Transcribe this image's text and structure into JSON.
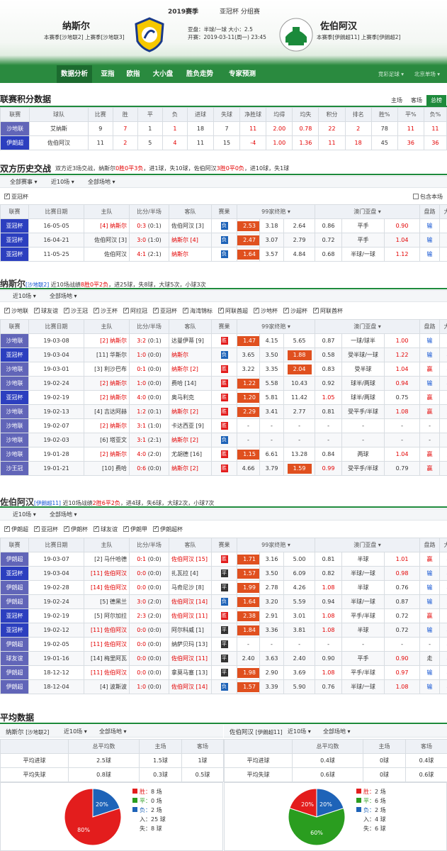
{
  "header": {
    "season": "2019赛季",
    "competition": "亚冠杯 分组赛",
    "home_team": "纳斯尔",
    "home_sub": "本赛季[沙地联2] 上赛季[沙地联3]",
    "away_team": "佐伯阿汉",
    "away_sub": "本赛季[伊朗超11] 上赛季[伊朗超2]",
    "handicap": "亚盘：半球/一球   大小：2.5",
    "kickoff": "开赛：2019-03-11(周一) 23:45"
  },
  "nav": {
    "items": [
      "数据分析",
      "亚指",
      "欧指",
      "大小盘",
      "胜负走势",
      "专家预测"
    ],
    "right1": "竞彩足球",
    "right2": "北京单场"
  },
  "league": {
    "title": "联赛积分数据",
    "tabs": [
      "主场",
      "客场",
      "总榜"
    ],
    "headers": [
      "联赛",
      "球队",
      "比赛",
      "胜",
      "平",
      "负",
      "进球",
      "失球",
      "净胜球",
      "均得",
      "均失",
      "积分",
      "排名",
      "胜%",
      "平%",
      "负%"
    ],
    "rows": [
      [
        "沙地联",
        "艾纳斯",
        "9",
        "7",
        "1",
        "1",
        "18",
        "7",
        "11",
        "2.00",
        "0.78",
        "22",
        "2",
        "78",
        "11",
        "11"
      ],
      [
        "伊朗超",
        "佐伯阿汉",
        "11",
        "2",
        "5",
        "4",
        "11",
        "15",
        "-4",
        "1.00",
        "1.36",
        "11",
        "18",
        "45",
        "36",
        "36"
      ]
    ]
  },
  "h2h": {
    "title": "双方历史交战",
    "summary_pre": "双方近3场交战，纳斯尔",
    "summary_rec1": "0胜0平3负",
    "summary_mid1": "，进1球，失10球，佐伯阿汉",
    "summary_rec2": "3胜0平0负",
    "summary_post": "，进10球，失1球",
    "filter1": "全部赛事",
    "filter2": "近10场",
    "filter3": "全部场地",
    "check1": "亚冠杯",
    "check2": "包含本场",
    "headers": [
      "联赛",
      "比赛日期",
      "主队",
      "比分/半场",
      "客队",
      "赛果",
      "99家终赔",
      "澳门亚盘",
      "盘路",
      "大小"
    ],
    "rows": [
      [
        "亚冠杯",
        "16-05-05",
        "[4] 纳斯尔",
        "0:3 (0:1)",
        "佐伯阿汉 [3]",
        "负",
        "2.53",
        "3.18",
        "2.64",
        "0.86",
        "平手",
        "0.90",
        "输",
        "大"
      ],
      [
        "亚冠杯",
        "16-04-21",
        "佐伯阿汉 [3]",
        "3:0 (1:0)",
        "纳斯尔 [4]",
        "负",
        "2.47",
        "3.07",
        "2.79",
        "0.72",
        "平手",
        "1.04",
        "输",
        "大"
      ],
      [
        "亚冠杯",
        "11-05-25",
        "佐伯阿汉",
        "4:1 (2:1)",
        "纳斯尔",
        "负",
        "1.64",
        "3.57",
        "4.84",
        "0.68",
        "半球/一球",
        "1.12",
        "输",
        "大"
      ]
    ]
  },
  "recent1": {
    "title": "纳斯尔",
    "tag": "[沙地联2]",
    "summary_pre": "近10场战绩",
    "rec": "8胜0平2负",
    "summary_post": "，进25球，失8球，大球5次，小球3次",
    "filter1": "近10场",
    "filter2": "全部场地",
    "checks": [
      "沙地联",
      "球友谊",
      "沙王冠",
      "沙王杯",
      "阿拉冠",
      "亚冠杯",
      "海湾锦标",
      "阿联酋超",
      "沙地杯",
      "沙超杯",
      "阿联酋杯"
    ],
    "rows": [
      [
        "沙地联",
        "19-03-08",
        "[2] 纳斯尔",
        "3:2 (0:1)",
        "达曼伊蒂 [9]",
        "胜",
        "1.47",
        "4.15",
        "5.65",
        "0.87",
        "一球/球半",
        "1.00",
        "输",
        "大"
      ],
      [
        "亚冠杯",
        "19-03-04",
        "[11] 华斯尔",
        "1:0 (0:0)",
        "纳斯尔",
        "负",
        "3.65",
        "3.50",
        "1.88",
        "0.58",
        "受半球/一球",
        "1.22",
        "输",
        "小"
      ],
      [
        "沙地联",
        "19-03-01",
        "[3] 利沙巴布",
        "0:1 (0:0)",
        "纳斯尔 [2]",
        "胜",
        "3.22",
        "3.35",
        "2.04",
        "0.83",
        "受半球",
        "1.04",
        "赢",
        "小"
      ],
      [
        "沙地联",
        "19-02-24",
        "[2] 纳斯尔",
        "1:0 (0:0)",
        "费哈 [14]",
        "胜",
        "1.22",
        "5.58",
        "10.43",
        "0.92",
        "球半/两球",
        "0.94",
        "输",
        "小"
      ],
      [
        "亚冠杯",
        "19-02-19",
        "[2] 纳斯尔",
        "4:0 (0:0)",
        "奥马利克",
        "胜",
        "1.20",
        "5.81",
        "11.42",
        "1.05",
        "球半/两球",
        "0.75",
        "赢",
        "大"
      ],
      [
        "沙地联",
        "19-02-13",
        "[4] 吉达阿赫",
        "1:2 (0:1)",
        "纳斯尔 [2]",
        "胜",
        "2.29",
        "3.41",
        "2.77",
        "0.81",
        "受平手/半球",
        "1.08",
        "赢",
        "大"
      ],
      [
        "沙地联",
        "19-02-07",
        "[2] 纳斯尔",
        "3:1 (1:0)",
        "卡达西亚 [9]",
        "胜",
        "-",
        "-",
        "-",
        "-",
        "-",
        "-",
        "-",
        "-"
      ],
      [
        "沙地联",
        "19-02-03",
        "[6] 塔亚文",
        "3:1 (2:1)",
        "纳斯尔 [2]",
        "负",
        "-",
        "-",
        "-",
        "-",
        "-",
        "-",
        "-",
        "-"
      ],
      [
        "沙地联",
        "19-01-28",
        "[2] 纳斯尔",
        "4:0 (2:0)",
        "尤胡德 [16]",
        "胜",
        "1.15",
        "6.61",
        "13.28",
        "0.84",
        "两球",
        "1.04",
        "赢",
        "大"
      ],
      [
        "沙王冠",
        "19-01-21",
        "[10] 费哈",
        "0:6 (0:0)",
        "纳斯尔 [2]",
        "胜",
        "4.66",
        "3.79",
        "1.59",
        "0.99",
        "受平手/半球",
        "0.79",
        "赢",
        "大"
      ]
    ]
  },
  "recent2": {
    "title": "佐伯阿汉",
    "tag": "[伊朗超11]",
    "summary_pre": "近10场战绩",
    "rec": "2胜6平2负",
    "summary_post": "，进4球，失6球，大球2次，小球7次",
    "filter1": "近10场",
    "filter2": "全部场地",
    "checks": [
      "伊朗超",
      "亚冠杯",
      "伊朗杯",
      "球友谊",
      "伊朗甲",
      "伊朗超杯"
    ],
    "rows": [
      [
        "伊朗超",
        "19-03-07",
        "[2] 马什哈德",
        "0:1 (0:0)",
        "佐伯阿汉 [15]",
        "胜",
        "1.71",
        "3.16",
        "5.00",
        "0.81",
        "半球",
        "1.01",
        "赢",
        "小"
      ],
      [
        "亚冠杯",
        "19-03-04",
        "[11] 佐伯阿汉",
        "0:0 (0:0)",
        "扎瓦拉 [4]",
        "平",
        "1.57",
        "3.50",
        "6.09",
        "0.82",
        "半球/一球",
        "0.98",
        "输",
        "小"
      ],
      [
        "伊朗超",
        "19-02-28",
        "[14] 佐伯阿汉",
        "0:0 (0:0)",
        "马奇尼沙 [8]",
        "平",
        "1.99",
        "2.78",
        "4.26",
        "1.08",
        "半球",
        "0.76",
        "输",
        "小"
      ],
      [
        "伊朗超",
        "19-02-24",
        "[5] 德黑兰",
        "3:0 (2:0)",
        "佐伯阿汉 [14]",
        "负",
        "1.64",
        "3.20",
        "5.59",
        "0.94",
        "半球/一球",
        "0.87",
        "输",
        "大"
      ],
      [
        "亚冠杯",
        "19-02-19",
        "[5] 阿尔加拉",
        "2:3 (2:0)",
        "佐伯阿汉 [11]",
        "胜",
        "2.38",
        "2.91",
        "3.01",
        "1.08",
        "平手/半球",
        "0.72",
        "赢",
        "大"
      ],
      [
        "亚冠杯",
        "19-02-12",
        "[11] 佐伯阿汉",
        "0:0 (0:0)",
        "阿尔科威 [1]",
        "平",
        "1.84",
        "3.36",
        "3.81",
        "1.08",
        "半球",
        "0.72",
        "输",
        "小"
      ],
      [
        "伊朗超",
        "19-02-05",
        "[11] 佐伯阿汉",
        "0:0 (0:0)",
        "纳萨贝玛 [13]",
        "平",
        "-",
        "-",
        "-",
        "-",
        "-",
        "-",
        "-",
        "小"
      ],
      [
        "球友谊",
        "19-01-16",
        "[14] 梅里阿瓦",
        "0:0 (0:0)",
        "佐伯阿汉 [11]",
        "平",
        "2.40",
        "3.63",
        "2.40",
        "0.90",
        "平手",
        "0.90",
        "走",
        "小"
      ],
      [
        "伊朗超",
        "18-12-12",
        "[11] 佐伯阿汉",
        "0:0 (0:0)",
        "拿莫马塞 [13]",
        "平",
        "1.98",
        "2.90",
        "3.69",
        "1.08",
        "平手/半球",
        "0.97",
        "输",
        "小"
      ],
      [
        "伊朗超",
        "18-12-04",
        "[4] 波斯波",
        "1:0 (0:0)",
        "佐伯阿汉 [14]",
        "负",
        "1.57",
        "3.39",
        "5.90",
        "0.76",
        "半球/一球",
        "1.08",
        "输",
        "小"
      ]
    ]
  },
  "avg": {
    "title": "平均数据",
    "left": {
      "team": "纳斯尔",
      "tag": "[沙地联2]",
      "f1": "近10场",
      "f2": "全部场地",
      "headers": [
        "总平均数",
        "主场",
        "客场"
      ],
      "rows": [
        [
          "平均进球",
          "2.5球",
          "1.5球",
          "1球"
        ],
        [
          "平均失球",
          "0.8球",
          "0.3球",
          "0.5球"
        ]
      ],
      "legend": [
        "胜：8 场",
        "平：0 场",
        "负：2 场",
        "入：25 球",
        "失：8 球"
      ],
      "pct_labels": [
        "80%",
        "20%"
      ]
    },
    "right": {
      "team": "佐伯阿汉",
      "tag": "[伊朗超11]",
      "f1": "近10场",
      "f2": "全部场地",
      "headers": [
        "总平均数",
        "主场",
        "客场"
      ],
      "rows": [
        [
          "平均进球",
          "0.4球",
          "0球",
          "0.4球"
        ],
        [
          "平均失球",
          "0.6球",
          "0球",
          "0.6球"
        ]
      ],
      "legend": [
        "胜：2 场",
        "平：6 场",
        "负：2 场",
        "入：4 球",
        "失：6 球"
      ],
      "pct_labels": [
        "60%",
        "20%",
        "20%"
      ]
    }
  },
  "colors": {
    "green": "#2a8a3f",
    "win": "#e31d1d",
    "draw": "#2a9d1f",
    "loss": "#1e63b8"
  }
}
